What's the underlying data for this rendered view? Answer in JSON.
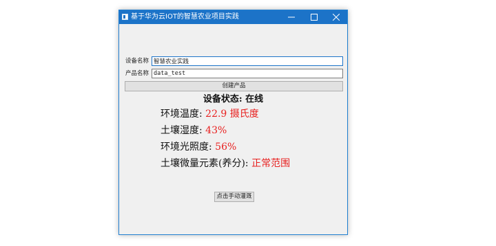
{
  "window": {
    "title": "基于华为云IOT的智慧农业项目实践",
    "controls": {
      "minimize_icon": "minimize-icon",
      "maximize_icon": "maximize-icon",
      "close_icon": "close-icon"
    },
    "accent_color": "#1c73c8"
  },
  "form": {
    "device_name_label": "设备名称",
    "device_name_value": "智慧农业实践",
    "product_name_label": "产品名称",
    "product_name_value": "data_test",
    "create_button_label": "创建产品"
  },
  "status": {
    "label": "设备状态:",
    "value": "在线"
  },
  "readings": [
    {
      "label": "环境温度:",
      "value": "22.9 摄氏度"
    },
    {
      "label": "土壤湿度:",
      "value": "43%"
    },
    {
      "label": "环境光照度:",
      "value": "56%"
    },
    {
      "label": "土壤微量元素(养分):",
      "value": "正常范围"
    }
  ],
  "value_color": "#e8201f",
  "water_button_label": "点击手动灌溉"
}
